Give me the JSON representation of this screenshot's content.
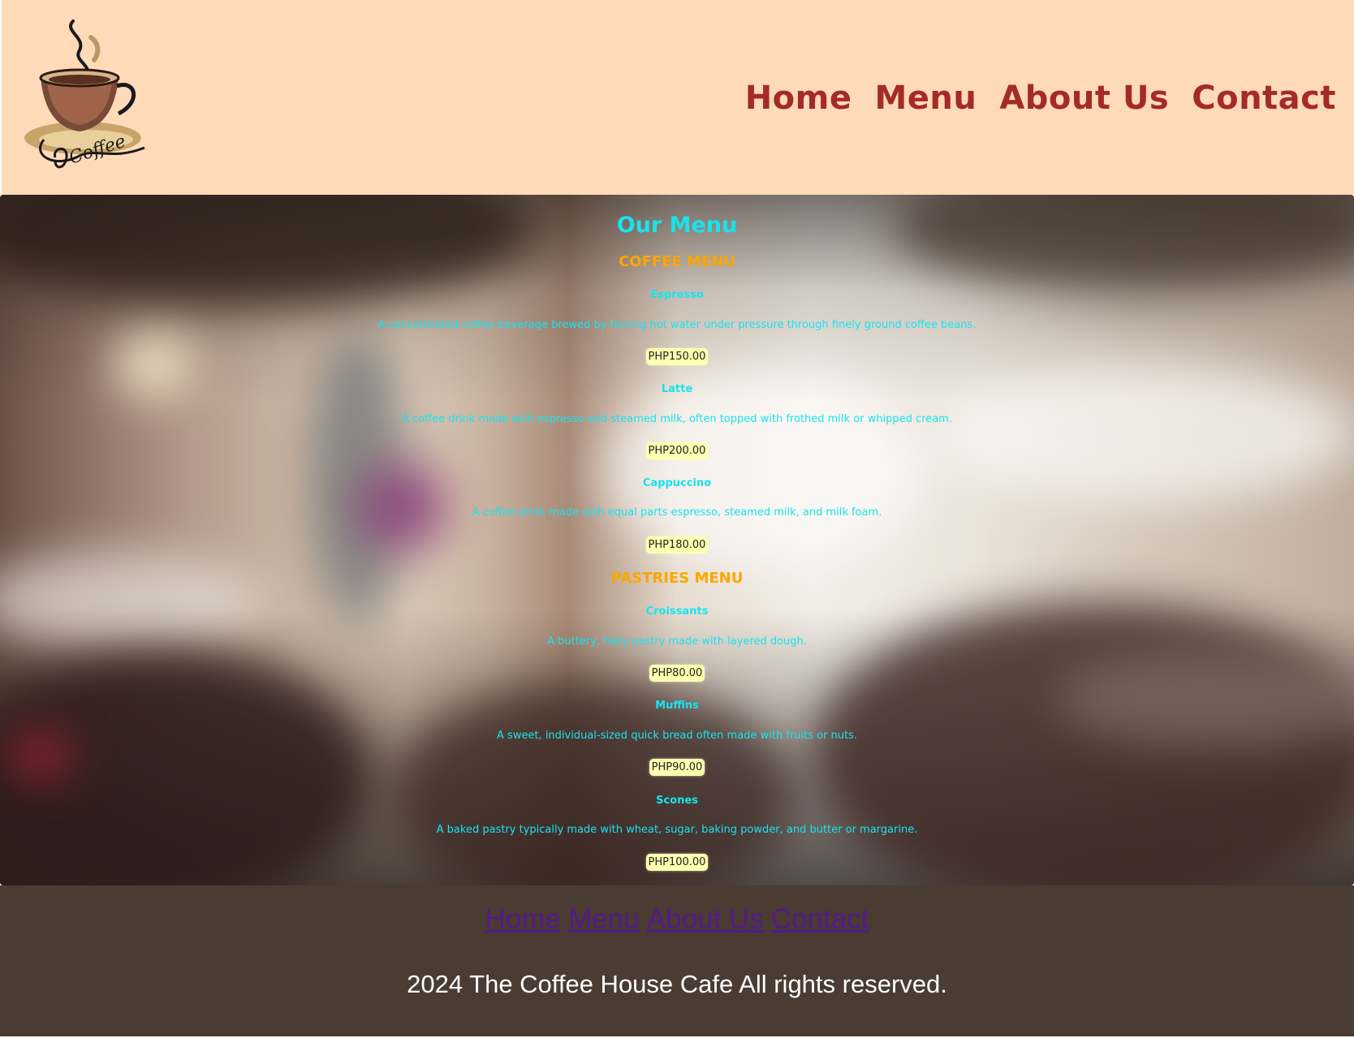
{
  "header": {
    "logo_text": "Coffee",
    "nav": [
      {
        "label": "Home"
      },
      {
        "label": "Menu"
      },
      {
        "label": "About Us"
      },
      {
        "label": "Contact"
      }
    ]
  },
  "menu": {
    "title": "Our Menu",
    "coffee": {
      "title": "COFFEE MENU",
      "items": [
        {
          "name": "Espresso",
          "desc": "A concentrated coffee beverage brewed by forcing hot water under pressure through finely ground coffee beans.",
          "price": "PHP150.00"
        },
        {
          "name": "Latte",
          "desc": "A coffee drink made with espresso and steamed milk, often topped with frothed milk or whipped cream.",
          "price": "PHP200.00"
        },
        {
          "name": "Cappuccino",
          "desc": "A coffee drink made with equal parts espresso, steamed milk, and milk foam.",
          "price": "PHP180.00"
        }
      ]
    },
    "pastries": {
      "title": "PASTRIES MENU",
      "items": [
        {
          "name": "Croissants",
          "desc": "A buttery, flaky pastry made with layered dough.",
          "price": "PHP80.00"
        },
        {
          "name": "Muffins",
          "desc": "A sweet, individual-sized quick bread often made with fruits or nuts.",
          "price": "PHP90.00"
        },
        {
          "name": "Scones",
          "desc": "A baked pastry typically made with wheat, sugar, baking powder, and butter or margarine.",
          "price": "PHP100.00"
        }
      ]
    }
  },
  "footer": {
    "nav": [
      {
        "label": "Home"
      },
      {
        "label": "Menu"
      },
      {
        "label": "About Us"
      },
      {
        "label": "Contact"
      }
    ],
    "copyright": "2024 The Coffee House Cafe All rights reserved."
  },
  "colors": {
    "header_bg": "#ffdab9",
    "nav_link": "#a52a2a",
    "menu_heading": "#18e3ef",
    "section_heading": "#ffa500",
    "price_bg": "#ffffb0",
    "footer_bg": "#4a3b33",
    "footer_link": "#551a8b"
  }
}
